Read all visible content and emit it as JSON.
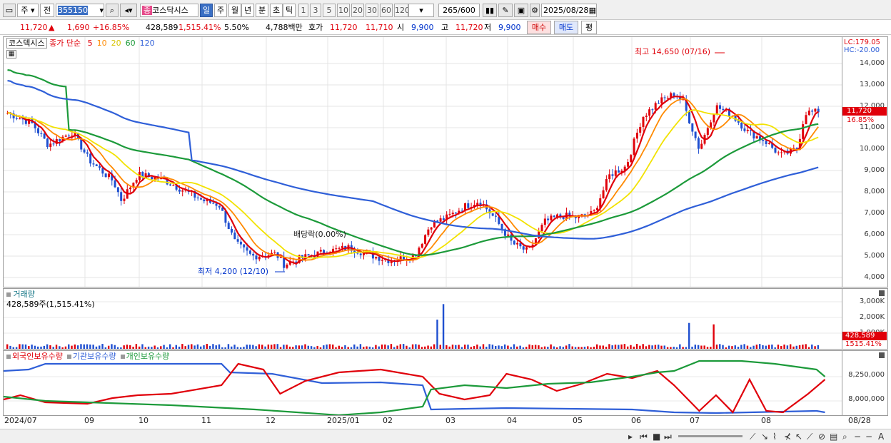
{
  "toolbar": {
    "type1": "주",
    "type2": "전",
    "code": "355150",
    "stock_name": "코스닥시스",
    "stock_name_tag": "종",
    "periods": [
      "일",
      "주",
      "월",
      "년",
      "분",
      "초",
      "틱"
    ],
    "active_period": "일",
    "minutes": [
      "1",
      "3",
      "5",
      "10",
      "20",
      "30",
      "60",
      "120"
    ],
    "count": "265",
    "count_total": "/600",
    "date": "2025/08/28"
  },
  "quote": {
    "price": "11,720",
    "change": "1,690",
    "change_pct": "+16.85%",
    "volume": "428,589",
    "volume_pct": "1,515.41%",
    "ratio": "5.50%",
    "amount": "4,788백만",
    "hoga_label": "호가",
    "ask": "11,720",
    "bid": "11,710",
    "open_label": "시",
    "open": "9,900",
    "high_label": "고",
    "high": "11,720",
    "low_label": "저",
    "low": "9,900",
    "buy": "매수",
    "sell": "매도",
    "flat": "평"
  },
  "price_panel": {
    "name": "코스덱시스",
    "legend_prefix": "종가 단순",
    "ma": [
      {
        "label": "5",
        "color": "#e0000a"
      },
      {
        "label": "10",
        "color": "#ff8a00"
      },
      {
        "label": "20",
        "color": "#f2e200"
      },
      {
        "label": "60",
        "color": "#1c9a3a"
      },
      {
        "label": "120",
        "color": "#2f5fd8"
      }
    ],
    "lc": "LC:179.05",
    "hc": "HC:-20.00",
    "high_note": "최고 14,650 (07/16)",
    "low_note": "최저 4,200 (12/10)",
    "dividend_note": "배당락(0.00%)",
    "cur_price": "11,720",
    "cur_pct": "16.85%",
    "y_ticks": [
      "14,000",
      "13,000",
      "12,000",
      "11,000",
      "10,000",
      "9,000",
      "8,000",
      "7,000",
      "6,000",
      "5,000",
      "4,000"
    ]
  },
  "volume_panel": {
    "name": "거래량",
    "desc": "428,589주(1,515.41%)",
    "y_ticks": [
      "3,000K",
      "2,000K",
      "1,000K"
    ],
    "cur_volume": "428,589",
    "cur_pct": "1515.41%"
  },
  "holdings_panel": {
    "labels": [
      "외국인보유수량",
      "기관보유수량",
      "개인보유수량"
    ],
    "colors": [
      "#e0000a",
      "#2f5fd8",
      "#1c9a3a"
    ],
    "y_ticks": [
      "8,250,000",
      "8,000,000"
    ]
  },
  "x_axis": {
    "labels": [
      "2024/07",
      "09",
      "10",
      "11",
      "12",
      "2025/01",
      "02",
      "03",
      "04",
      "05",
      "06",
      "07",
      "08",
      "08/28"
    ]
  },
  "colors": {
    "up": "#e0000a",
    "down": "#1f4fd0",
    "accent": "#3a6fc4"
  }
}
